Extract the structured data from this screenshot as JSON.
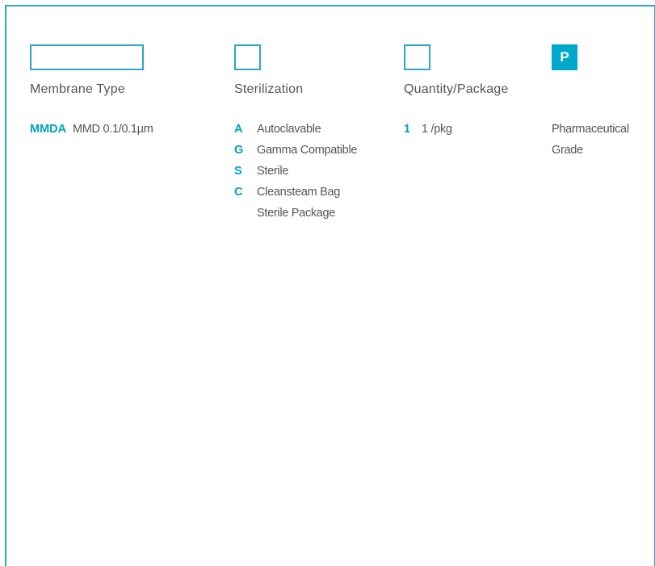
{
  "colors": {
    "accent": "#00a9cc",
    "border": "#2aa7c9",
    "text": "#555555"
  },
  "columns": [
    {
      "title": "Membrane Type",
      "options": [
        {
          "code": "MMDA",
          "label": "MMD 0.1/0.1µm"
        }
      ]
    },
    {
      "title": "Sterilization",
      "options": [
        {
          "code": "A",
          "label": "Autoclavable"
        },
        {
          "code": "G",
          "label": "Gamma Compatible"
        },
        {
          "code": "S",
          "label": "Sterile"
        },
        {
          "code": "C",
          "label": "Cleansteam Bag Sterile Package"
        }
      ]
    },
    {
      "title": "Quantity/Package",
      "options": [
        {
          "code": "1",
          "label": "1 /pkg"
        }
      ]
    },
    {
      "title": "",
      "fixed_code": "P",
      "description": "Pharmaceutical Grade"
    }
  ]
}
